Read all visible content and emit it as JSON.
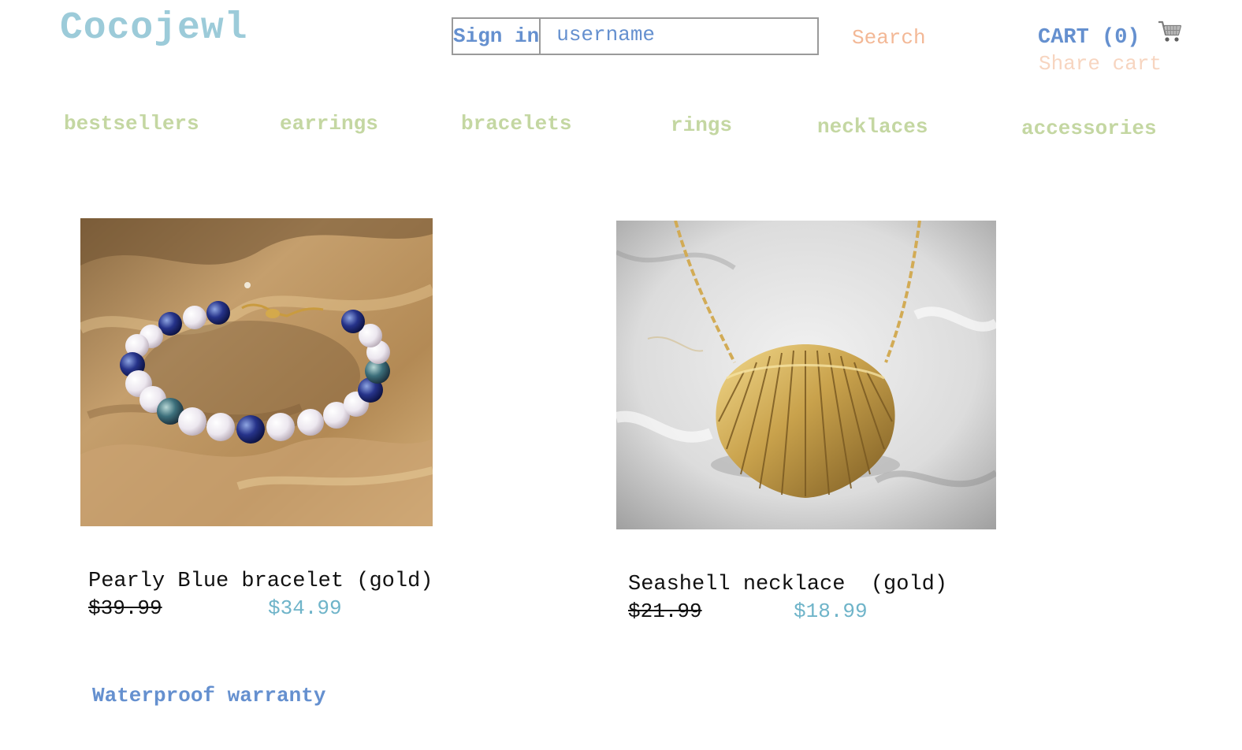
{
  "header": {
    "logo": "Cocojewl",
    "signin_label": "Sign in",
    "username_placeholder": "username",
    "search_label": "Search",
    "cart_label": "CART (0)",
    "share_cart_label": "Share cart",
    "cart_icon": "shopping-cart-icon"
  },
  "nav": {
    "items": [
      {
        "label": "bestsellers"
      },
      {
        "label": "earrings"
      },
      {
        "label": "bracelets"
      },
      {
        "label": "rings"
      },
      {
        "label": "necklaces"
      },
      {
        "label": "accessories"
      }
    ]
  },
  "products": [
    {
      "name": "Pearly Blue bracelet (gold)",
      "old_price": "$39.99",
      "price": "$34.99",
      "image": "pearl-bracelet-on-sand"
    },
    {
      "name": "Seashell necklace  (gold)",
      "old_price": "$21.99",
      "price": "$18.99",
      "image": "gold-seashell-necklace-on-marble"
    }
  ],
  "footer": {
    "warranty_label": "Waterproof warranty"
  },
  "colors": {
    "logo": "#9ccbd9",
    "accent_blue": "#6590cf",
    "search_peach": "#f3b896",
    "share_peach": "#f7d5c0",
    "nav_green": "#c4d7a2",
    "sale_price": "#6fb4c9"
  }
}
